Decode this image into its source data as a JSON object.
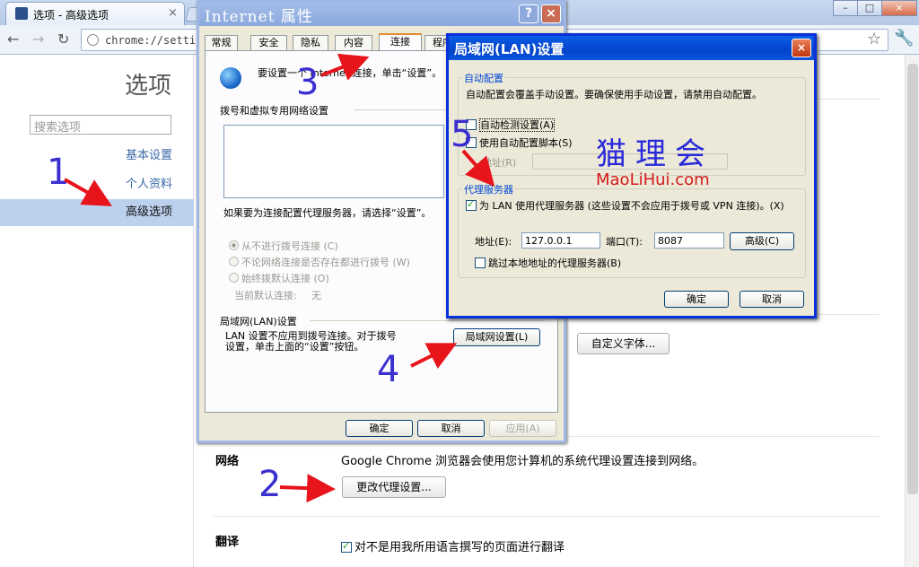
{
  "browser": {
    "tab_title": "选项 - 高级选项",
    "tab_close": "×",
    "url": "chrome://settings/advanced",
    "window_buttons": [
      "–",
      "□",
      "×"
    ]
  },
  "sidebar": {
    "title": "选项",
    "search_placeholder": "搜索选项",
    "items": [
      {
        "label": "基本设置"
      },
      {
        "label": "个人资料"
      },
      {
        "label": "高级选项"
      }
    ]
  },
  "main": {
    "custom_font_button": "自定义字体...",
    "network": {
      "heading": "网络",
      "description": "Google Chrome 浏览器会使用您计算机的系统代理设置连接到网络。",
      "button": "更改代理设置..."
    },
    "translate": {
      "heading": "翻译",
      "checkbox_label": "对不是用我所用语言撰写的页面进行翻译",
      "checked": true
    }
  },
  "internet_properties": {
    "title": "Internet 属性",
    "help_btn": "?",
    "close_btn": "×",
    "tabs": [
      "常规",
      "安全",
      "隐私",
      "内容",
      "连接",
      "程序"
    ],
    "active_tab": "连接",
    "setup_text": "要设置一个 Internet 连接，单击“设置”。",
    "dialup_section": "拨号和虚拟专用网络设置",
    "proxy_hint": "如果要为连接配置代理服务器，请选择“设置”。",
    "radio_options": [
      "从不进行拨号连接 (C)",
      "不论网络连接是否存在都进行拨号 (W)",
      "始终拨默认连接 (O)"
    ],
    "current_default_label": "当前默认连接:",
    "current_default_value": "无",
    "lan_section": "局域网(LAN)设置",
    "lan_text": "LAN 设置不应用到拨号连接。对于拨号设置，单击上面的“设置”按钮。",
    "lan_button": "局域网设置(L)",
    "ok": "确定",
    "cancel": "取消",
    "apply": "应用(A)"
  },
  "lan_settings": {
    "title": "局域网(LAN)设置",
    "close_btn": "×",
    "auto_config_group": "自动配置",
    "auto_config_text": "自动配置会覆盖手动设置。要确保使用手动设置，请禁用自动配置。",
    "auto_detect": {
      "label": "自动检测设置(A)",
      "checked": false
    },
    "auto_script": {
      "label": "使用自动配置脚本(S)",
      "checked": false
    },
    "address_label": "地址(R)",
    "proxy_group": "代理服务器",
    "use_proxy": {
      "label": "为 LAN 使用代理服务器 (这些设置不会应用于拨号或 VPN 连接)。(X)",
      "checked": true
    },
    "proxy_address_label": "地址(E):",
    "proxy_address": "127.0.0.1",
    "port_label": "端口(T):",
    "port": "8087",
    "advanced_button": "高级(C)",
    "bypass_local": {
      "label": "跳过本地地址的代理服务器(B)",
      "checked": false
    },
    "ok": "确定",
    "cancel": "取消"
  },
  "annotations": {
    "steps": [
      "1",
      "2",
      "3",
      "4",
      "5"
    ],
    "watermark_cn": "猫理会",
    "watermark_url": "MaoLiHui.com",
    "arrow_color": "#e8141b"
  }
}
